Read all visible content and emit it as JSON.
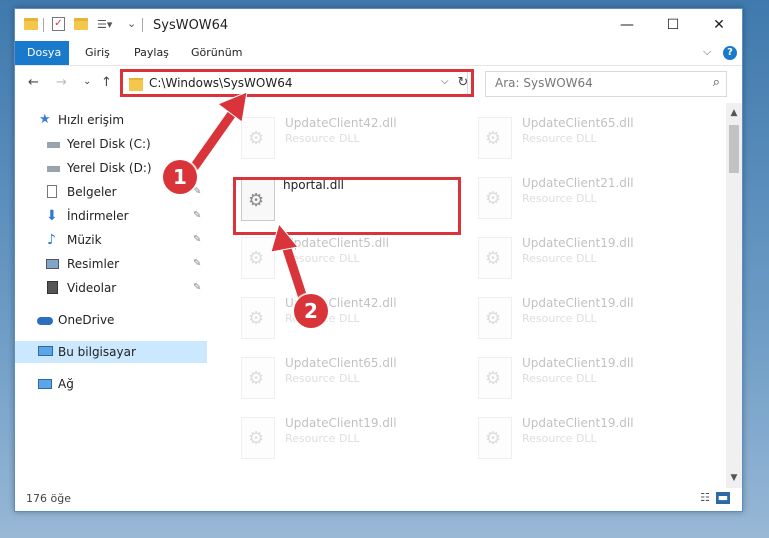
{
  "window": {
    "title": "SysWOW64",
    "controls": {
      "minimize": "—",
      "maximize": "☐",
      "close": "✕"
    }
  },
  "ribbon": {
    "tabs": [
      "Dosya",
      "Giriş",
      "Paylaş",
      "Görünüm"
    ],
    "expand_icon": "⌵",
    "help_icon": "?"
  },
  "nav": {
    "back": "←",
    "forward": "→",
    "recent": "⌄",
    "up": "↑"
  },
  "address": {
    "path": "C:\\Windows\\SysWOW64",
    "dropdown": "⌵",
    "refresh": "↻"
  },
  "search": {
    "placeholder": "Ara: SysWOW64",
    "icon": "⌕"
  },
  "sidebar": {
    "items": [
      {
        "label": "Hızlı erişim",
        "icon": "star-icon"
      },
      {
        "label": "Yerel Disk (C:)",
        "icon": "drive-icon"
      },
      {
        "label": "Yerel Disk (D:)",
        "icon": "drive-icon"
      },
      {
        "label": "Belgeler",
        "icon": "documents-icon",
        "pin": "📌"
      },
      {
        "label": "İndirmeler",
        "icon": "download-icon",
        "pin": "📌"
      },
      {
        "label": "Müzik",
        "icon": "music-icon",
        "pin": "📌"
      },
      {
        "label": "Resimler",
        "icon": "pictures-icon",
        "pin": "📌"
      },
      {
        "label": "Videolar",
        "icon": "videos-icon",
        "pin": "📌"
      },
      {
        "label": "OneDrive",
        "icon": "cloud-icon"
      },
      {
        "label": "Bu bilgisayar",
        "icon": "computer-icon"
      },
      {
        "label": "Ağ",
        "icon": "network-icon"
      }
    ]
  },
  "files": [
    {
      "name": "UpdateClient42.dll",
      "type": "Resource DLL"
    },
    {
      "name": "UpdateClient65.dll",
      "type": "Resource DLL"
    },
    {
      "name": "hportal.dll",
      "type": ""
    },
    {
      "name": "UpdateClient21.dll",
      "type": "Resource DLL"
    },
    {
      "name": "UpdateClient5.dll",
      "type": "Resource DLL"
    },
    {
      "name": "UpdateClient19.dll",
      "type": "Resource DLL"
    },
    {
      "name": "UpdateClient42.dll",
      "type": "Resource DLL"
    },
    {
      "name": "UpdateClient19.dll",
      "type": "Resource DLL"
    },
    {
      "name": "UpdateClient65.dll",
      "type": "Resource DLL"
    },
    {
      "name": "UpdateClient19.dll",
      "type": "Resource DLL"
    },
    {
      "name": "UpdateClient19.dll",
      "type": "Resource DLL"
    },
    {
      "name": "UpdateClient19.dll",
      "type": "Resource DLL"
    }
  ],
  "status": {
    "count": "176 öğe"
  },
  "annotations": {
    "step1": "1",
    "step2": "2"
  },
  "colors": {
    "accent": "#1979ca",
    "highlight": "#d9343a",
    "selected": "#cce8ff"
  }
}
